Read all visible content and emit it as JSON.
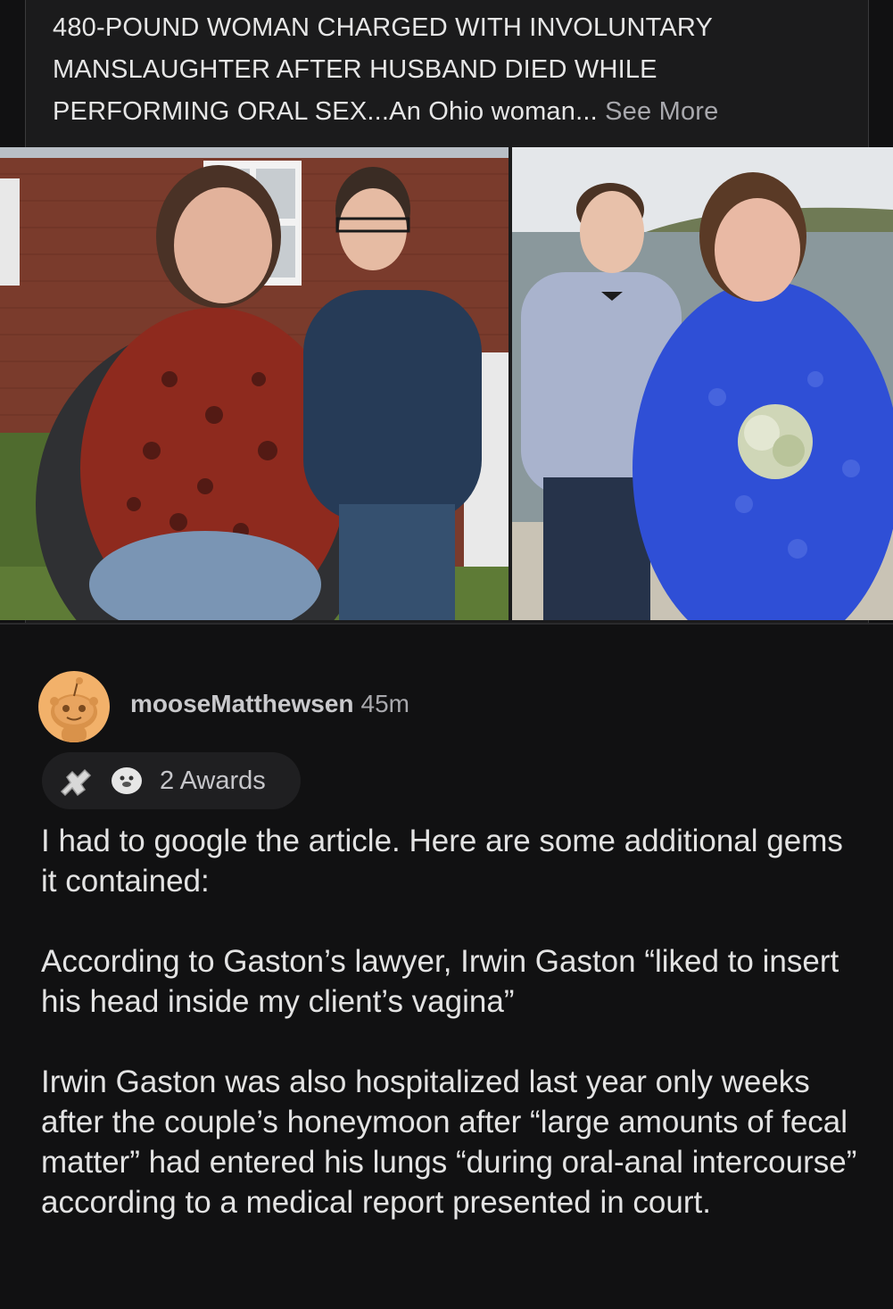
{
  "post": {
    "headline": "480-POUND WOMAN CHARGED WITH INVOLUNTARY MANSLAUGHTER AFTER HUSBAND DIED WHILE PERFORMING ORAL SEX...An Ohio woman...",
    "see_more_label": "See More"
  },
  "photos": [
    {
      "icon": "photo-couple-outside-house"
    },
    {
      "icon": "photo-couple-wedding-by-sea"
    }
  ],
  "comment": {
    "author": "mooseMatthewsen",
    "time": "45m",
    "awards_label": "2 Awards",
    "award_icons": [
      "arm-wrestle-award-icon",
      "seal-award-icon"
    ],
    "paragraphs": [
      "I had to google the article. Here are some additional gems it contained:",
      "According to Gaston’s lawyer, Irwin Gaston “liked to insert his head inside my client’s vagina”",
      "Irwin Gaston was also hospitalized last year only weeks after the couple’s honeymoon after “large amounts of fecal matter” had entered his lungs “during oral-anal intercourse” according to a medical report presented in court."
    ]
  },
  "colors": {
    "background": "#111112",
    "card": "#1b1b1c",
    "avatar": "#f2b16a",
    "dress_blue": "#2f4fd6"
  }
}
